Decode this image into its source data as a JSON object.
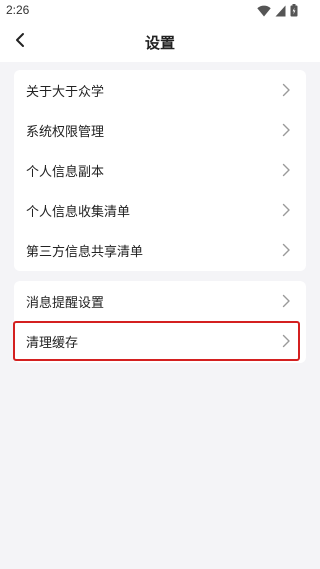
{
  "status_bar": {
    "time": "2:26",
    "icons": [
      "wifi-icon",
      "signal-icon",
      "battery-icon"
    ]
  },
  "header": {
    "title": "设置",
    "back_icon": "chevron-left-icon"
  },
  "settings": {
    "group1": [
      {
        "label": "关于大于众学"
      },
      {
        "label": "系统权限管理"
      },
      {
        "label": "个人信息副本"
      },
      {
        "label": "个人信息收集清单"
      },
      {
        "label": "第三方信息共享清单"
      }
    ],
    "group2": [
      {
        "label": "消息提醒设置"
      },
      {
        "label": "清理缓存",
        "highlighted": true
      }
    ]
  },
  "colors": {
    "background": "#f4f4f7",
    "card": "#ffffff",
    "highlight_border": "#d42020",
    "chevron": "#9a9a9a"
  }
}
